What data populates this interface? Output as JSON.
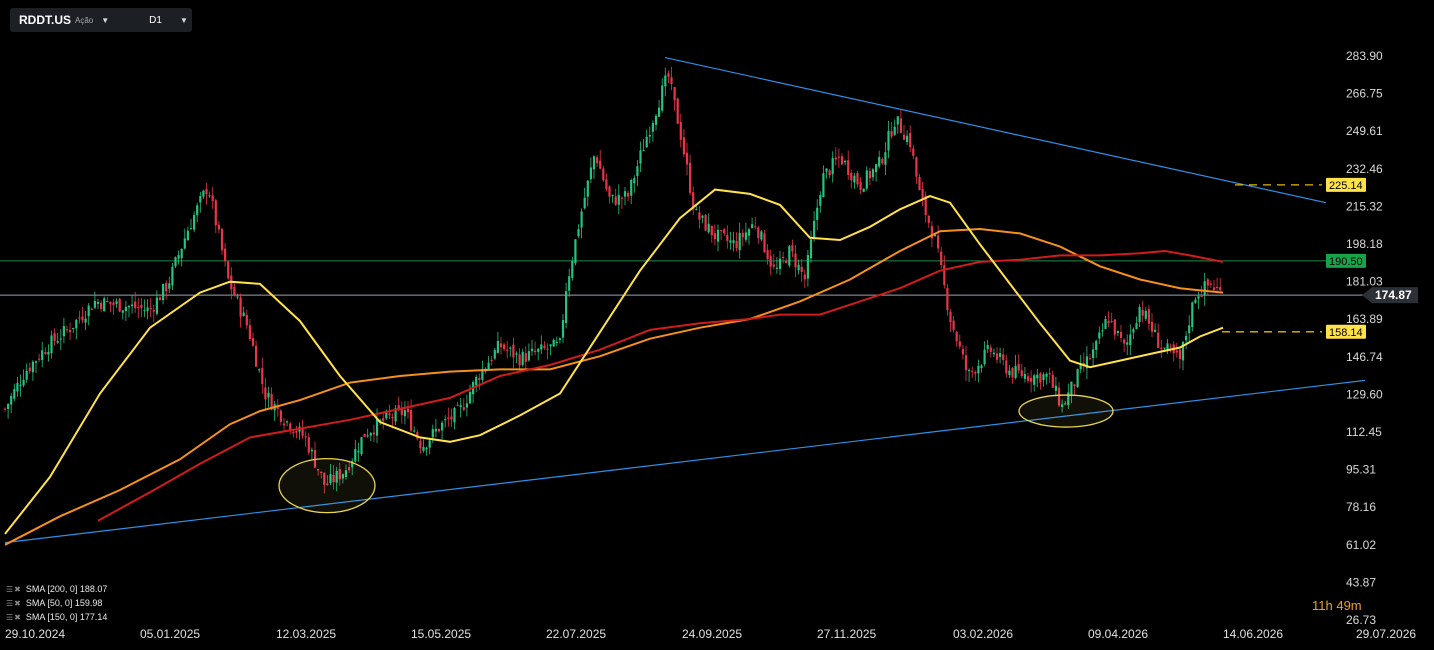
{
  "toolbar": {
    "symbol": "RDDT.US",
    "type": "Ação",
    "timeframe": "D1",
    "caret_icon": "chevron-down-icon"
  },
  "timer": "11h 49m",
  "legend": [
    {
      "label": "SMA [200, 0] 188.07",
      "color": "#d01c1c"
    },
    {
      "label": "SMA [50, 0] 159.98",
      "color": "#ffe14a"
    },
    {
      "label": "SMA [150, 0] 177.14",
      "color": "#f5901e"
    }
  ],
  "chart_data": {
    "type": "candlestick",
    "y_ticks": [
      283.9,
      266.75,
      249.61,
      232.46,
      215.32,
      198.18,
      181.03,
      163.89,
      146.74,
      129.6,
      112.45,
      95.31,
      78.16,
      61.02,
      43.87,
      26.73
    ],
    "y_tick_labels": [
      "283.90",
      "266.75",
      "249.61",
      "232.46",
      "215.32",
      "198.18",
      "181.03",
      "163.89",
      "146.74",
      "129.60",
      "112.45",
      "95.31",
      "78.16",
      "61.02",
      "43.87",
      "26.73"
    ],
    "ylim": [
      26.73,
      283.9
    ],
    "x_tick_labels": [
      "29.10.2024",
      "05.01.2025",
      "12.03.2025",
      "15.05.2025",
      "22.07.2025",
      "24.09.2025",
      "27.11.2025",
      "03.02.2026",
      "09.04.2026",
      "14.06.2026",
      "29.07.2026"
    ],
    "price_labels": [
      {
        "label": "225.14",
        "value": 225.14,
        "color": "#ffe14a",
        "text_color": "#000"
      },
      {
        "label": "190.50",
        "value": 190.5,
        "color": "#16a34a",
        "text_color": "#000"
      },
      {
        "label": "174.87",
        "value": 174.87,
        "color": "#2b2f36",
        "text_color": "#fff"
      },
      {
        "label": "158.14",
        "value": 158.14,
        "color": "#ffe14a",
        "text_color": "#000"
      }
    ],
    "horizontal_lines": [
      {
        "value": 190.5,
        "color": "#1f8a4c"
      },
      {
        "value": 174.87,
        "color": "#9aa3b0"
      }
    ],
    "colors": {
      "up": "#26c281",
      "down": "#e8354a",
      "trend": "#2f8fe6",
      "ellipse": "#e8d44d"
    },
    "anchor_points": [
      {
        "x": 5,
        "v": 123
      },
      {
        "x": 25,
        "v": 140
      },
      {
        "x": 48,
        "v": 152
      },
      {
        "x": 70,
        "v": 160
      },
      {
        "x": 95,
        "v": 172
      },
      {
        "x": 125,
        "v": 170
      },
      {
        "x": 150,
        "v": 168
      },
      {
        "x": 168,
        "v": 180
      },
      {
        "x": 188,
        "v": 205
      },
      {
        "x": 208,
        "v": 225
      },
      {
        "x": 228,
        "v": 182
      },
      {
        "x": 248,
        "v": 160
      },
      {
        "x": 265,
        "v": 130
      },
      {
        "x": 285,
        "v": 118
      },
      {
        "x": 305,
        "v": 110
      },
      {
        "x": 325,
        "v": 88
      },
      {
        "x": 345,
        "v": 95
      },
      {
        "x": 365,
        "v": 112
      },
      {
        "x": 385,
        "v": 118
      },
      {
        "x": 405,
        "v": 122
      },
      {
        "x": 422,
        "v": 106
      },
      {
        "x": 440,
        "v": 115
      },
      {
        "x": 460,
        "v": 122
      },
      {
        "x": 478,
        "v": 138
      },
      {
        "x": 500,
        "v": 152
      },
      {
        "x": 520,
        "v": 146
      },
      {
        "x": 545,
        "v": 150
      },
      {
        "x": 560,
        "v": 152
      },
      {
        "x": 566,
        "v": 178
      },
      {
        "x": 580,
        "v": 210
      },
      {
        "x": 595,
        "v": 240
      },
      {
        "x": 610,
        "v": 218
      },
      {
        "x": 628,
        "v": 220
      },
      {
        "x": 645,
        "v": 245
      },
      {
        "x": 660,
        "v": 265
      },
      {
        "x": 668,
        "v": 275
      },
      {
        "x": 680,
        "v": 250
      },
      {
        "x": 695,
        "v": 212
      },
      {
        "x": 715,
        "v": 202
      },
      {
        "x": 735,
        "v": 198
      },
      {
        "x": 755,
        "v": 208
      },
      {
        "x": 775,
        "v": 185
      },
      {
        "x": 790,
        "v": 195
      },
      {
        "x": 805,
        "v": 182
      },
      {
        "x": 822,
        "v": 228
      },
      {
        "x": 840,
        "v": 238
      },
      {
        "x": 860,
        "v": 225
      },
      {
        "x": 880,
        "v": 235
      },
      {
        "x": 895,
        "v": 255
      },
      {
        "x": 910,
        "v": 245
      },
      {
        "x": 920,
        "v": 220
      },
      {
        "x": 935,
        "v": 200
      },
      {
        "x": 950,
        "v": 165
      },
      {
        "x": 968,
        "v": 138
      },
      {
        "x": 990,
        "v": 150
      },
      {
        "x": 1010,
        "v": 140
      },
      {
        "x": 1030,
        "v": 138
      },
      {
        "x": 1048,
        "v": 138
      },
      {
        "x": 1062,
        "v": 124
      },
      {
        "x": 1080,
        "v": 140
      },
      {
        "x": 1095,
        "v": 150
      },
      {
        "x": 1108,
        "v": 165
      },
      {
        "x": 1125,
        "v": 150
      },
      {
        "x": 1140,
        "v": 170
      },
      {
        "x": 1160,
        "v": 152
      },
      {
        "x": 1180,
        "v": 145
      },
      {
        "x": 1195,
        "v": 175
      },
      {
        "x": 1210,
        "v": 180
      },
      {
        "x": 1223,
        "v": 175
      }
    ],
    "sma50": [
      [
        5,
        66
      ],
      [
        50,
        92
      ],
      [
        100,
        130
      ],
      [
        150,
        160
      ],
      [
        200,
        176
      ],
      [
        230,
        181
      ],
      [
        260,
        180
      ],
      [
        300,
        163
      ],
      [
        340,
        138
      ],
      [
        380,
        117
      ],
      [
        420,
        110
      ],
      [
        450,
        108
      ],
      [
        480,
        111
      ],
      [
        520,
        120
      ],
      [
        560,
        130
      ],
      [
        600,
        158
      ],
      [
        640,
        186
      ],
      [
        680,
        210
      ],
      [
        715,
        223
      ],
      [
        750,
        221
      ],
      [
        780,
        216
      ],
      [
        810,
        201
      ],
      [
        840,
        200
      ],
      [
        870,
        206
      ],
      [
        900,
        214
      ],
      [
        930,
        220
      ],
      [
        950,
        217
      ],
      [
        980,
        198
      ],
      [
        1010,
        180
      ],
      [
        1040,
        162
      ],
      [
        1070,
        145
      ],
      [
        1090,
        142
      ],
      [
        1120,
        145
      ],
      [
        1150,
        148
      ],
      [
        1180,
        151
      ],
      [
        1200,
        156
      ],
      [
        1223,
        160
      ]
    ],
    "sma150": [
      [
        5,
        61
      ],
      [
        60,
        74
      ],
      [
        120,
        86
      ],
      [
        180,
        100
      ],
      [
        230,
        116
      ],
      [
        260,
        122
      ],
      [
        300,
        127
      ],
      [
        350,
        135
      ],
      [
        400,
        138
      ],
      [
        450,
        140
      ],
      [
        500,
        141
      ],
      [
        550,
        141
      ],
      [
        600,
        147
      ],
      [
        650,
        155
      ],
      [
        700,
        160
      ],
      [
        750,
        164
      ],
      [
        800,
        172
      ],
      [
        850,
        182
      ],
      [
        900,
        195
      ],
      [
        940,
        204
      ],
      [
        980,
        205
      ],
      [
        1020,
        203
      ],
      [
        1060,
        197
      ],
      [
        1100,
        188
      ],
      [
        1140,
        182
      ],
      [
        1180,
        178
      ],
      [
        1200,
        177
      ],
      [
        1223,
        176
      ]
    ],
    "sma200": [
      [
        98,
        72
      ],
      [
        150,
        85
      ],
      [
        200,
        98
      ],
      [
        250,
        110
      ],
      [
        300,
        114
      ],
      [
        350,
        118
      ],
      [
        400,
        123
      ],
      [
        450,
        128
      ],
      [
        500,
        138
      ],
      [
        550,
        143
      ],
      [
        600,
        150
      ],
      [
        650,
        159
      ],
      [
        700,
        162
      ],
      [
        750,
        164
      ],
      [
        780,
        166
      ],
      [
        820,
        166
      ],
      [
        860,
        172
      ],
      [
        900,
        178
      ],
      [
        940,
        186
      ],
      [
        980,
        190
      ],
      [
        1020,
        191
      ],
      [
        1060,
        193
      ],
      [
        1100,
        193
      ],
      [
        1140,
        194
      ],
      [
        1165,
        195
      ],
      [
        1190,
        193
      ],
      [
        1223,
        190
      ]
    ],
    "trendlines": [
      {
        "x1": 5,
        "v1": 62,
        "x2": 1365,
        "v2": 136
      },
      {
        "x1": 665,
        "v1": 283.2,
        "x2": 1326,
        "v2": 217
      }
    ],
    "dashed_levels": [
      {
        "x1": 1235,
        "x2": 1322,
        "value": 225.14
      },
      {
        "x1": 1222,
        "x2": 1322,
        "value": 158.14
      }
    ],
    "ellipses": [
      {
        "cx": 327,
        "cy_value": 88,
        "rx": 48,
        "ry": 27
      },
      {
        "cx": 1066,
        "cy_value": 122,
        "rx": 47,
        "ry": 16
      }
    ]
  }
}
